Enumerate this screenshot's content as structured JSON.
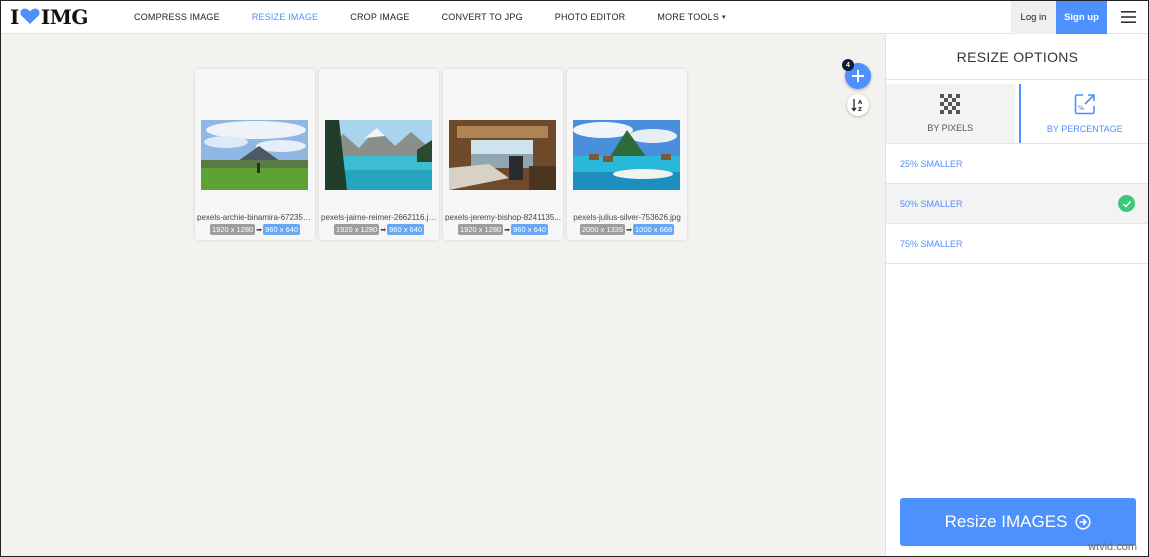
{
  "brand": {
    "logo_left": "I",
    "logo_right": "IMG",
    "heart_color": "#4d90fe"
  },
  "nav": {
    "items": [
      {
        "label": "COMPRESS IMAGE"
      },
      {
        "label": "RESIZE IMAGE",
        "active": true
      },
      {
        "label": "CROP IMAGE"
      },
      {
        "label": "CONVERT TO JPG"
      },
      {
        "label": "PHOTO EDITOR"
      },
      {
        "label": "MORE TOOLS",
        "caret": "▾"
      }
    ],
    "login": "Log in",
    "signup": "Sign up"
  },
  "workspace": {
    "file_count": "4",
    "files": [
      {
        "name": "pexels-archie-binamira-672358...",
        "original": "1920 x 1280",
        "resized": "960 x 640"
      },
      {
        "name": "pexels-jaime-reimer-2662116.jp...",
        "original": "1920 x 1280",
        "resized": "960 x 640"
      },
      {
        "name": "pexels-jeremy-bishop-8241135...",
        "original": "1920 x 1280",
        "resized": "960 x 640"
      },
      {
        "name": "pexels-julius-silver-753626.jpg",
        "original": "2000 x 1335",
        "resized": "1000 x 668"
      }
    ],
    "dim_arrow": "➡"
  },
  "sidebar": {
    "title": "RESIZE OPTIONS",
    "tabs": [
      {
        "label": "BY PIXELS",
        "icon": "pixels-grid-icon"
      },
      {
        "label": "BY PERCENTAGE",
        "icon": "resize-percent-icon",
        "active": true
      }
    ],
    "options": [
      {
        "label": "25% SMALLER"
      },
      {
        "label": "50% SMALLER",
        "selected": true
      },
      {
        "label": "75% SMALLER"
      }
    ],
    "action": "Resize IMAGES"
  },
  "watermark": "wtvid.com",
  "colors": {
    "accent": "#4d90fe",
    "check": "#3ec77a",
    "workspace_bg": "#f4f2ee"
  }
}
